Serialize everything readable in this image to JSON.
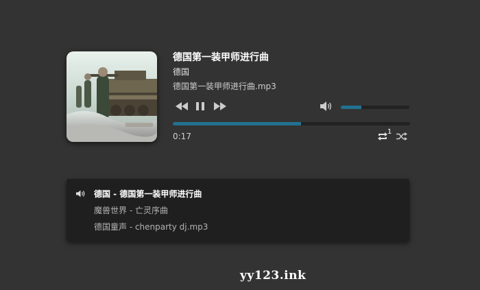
{
  "player": {
    "title": "德国第一装甲师进行曲",
    "artist": "德国",
    "filename": "德国第一装甲师进行曲.mp3",
    "current_time": "0:17",
    "progress_fraction": 0.54,
    "volume_fraction": 0.3,
    "repeat_count": "1",
    "accent_color": "#22718f",
    "icons": {
      "previous": "rewind-icon",
      "pause": "pause-icon",
      "next": "fast-forward-icon",
      "volume": "volume-icon",
      "repeat": "repeat-icon",
      "shuffle": "shuffle-icon"
    }
  },
  "playlist": {
    "items": [
      {
        "label": "德国 - 德国第一装甲师进行曲",
        "active": true
      },
      {
        "label": "魔兽世界 - 亡灵序曲",
        "active": false
      },
      {
        "label": "德国童声 - chenparty dj.mp3",
        "active": false
      }
    ]
  },
  "watermark": "yy123.ink"
}
